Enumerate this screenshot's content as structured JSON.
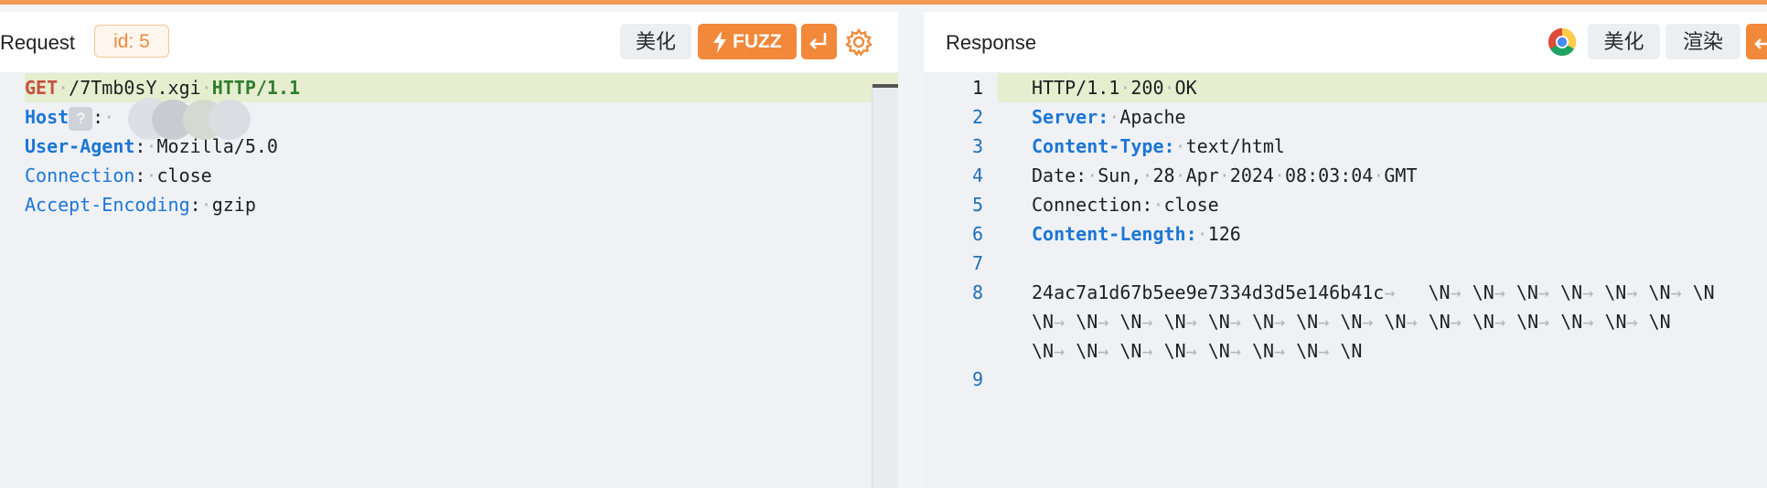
{
  "request": {
    "title": "Request",
    "id_badge": "id: 5",
    "beautify_label": "美化",
    "fuzz_label": "FUZZ",
    "lines": {
      "l1": {
        "method": "GET",
        "path": "/7Tmb0sY.xgi",
        "protocol": "HTTP/1.1"
      },
      "l2": {
        "key": "Host",
        "help": "?",
        "sep": ":"
      },
      "l3": {
        "key": "User-Agent",
        "sep": ":",
        "value": "Mozilla/5.0"
      },
      "l4": {
        "key": "Connection",
        "sep": ":",
        "value": "close"
      },
      "l5": {
        "key": "Accept-Encoding",
        "sep": ":",
        "value": "gzip"
      }
    }
  },
  "response": {
    "title": "Response",
    "beautify_label": "美化",
    "render_label": "渲染",
    "line_numbers": [
      "1",
      "2",
      "3",
      "4",
      "5",
      "6",
      "7",
      "8",
      "9"
    ],
    "lines": {
      "l1": {
        "protocol": "HTTP/1.1",
        "code": "200",
        "status": "OK"
      },
      "l2": {
        "key": "Server:",
        "value": "Apache"
      },
      "l3": {
        "key": "Content-Type:",
        "value": "text/html"
      },
      "l4": {
        "key": "Date:",
        "v1": "Sun,",
        "v2": "28",
        "v3": "Apr",
        "v4": "2024",
        "v5": "08:03:04",
        "v6": "GMT"
      },
      "l5": {
        "key": "Connection:",
        "value": "close"
      },
      "l6": {
        "key": "Content-Length:",
        "value": "126"
      },
      "l8": {
        "hash": "24ac7a1d67b5ee9e7334d3d5e146b41c"
      },
      "body_token": "\\N"
    }
  },
  "colors": {
    "accent": "#f2883a",
    "line_highlight": "#e6eecf",
    "header_key": "#1c76d6",
    "method": "#c4523f",
    "protocol": "#2f7d2f"
  },
  "icons": [
    "bolt-icon",
    "wrap-icon",
    "gear-icon",
    "chrome-icon"
  ]
}
